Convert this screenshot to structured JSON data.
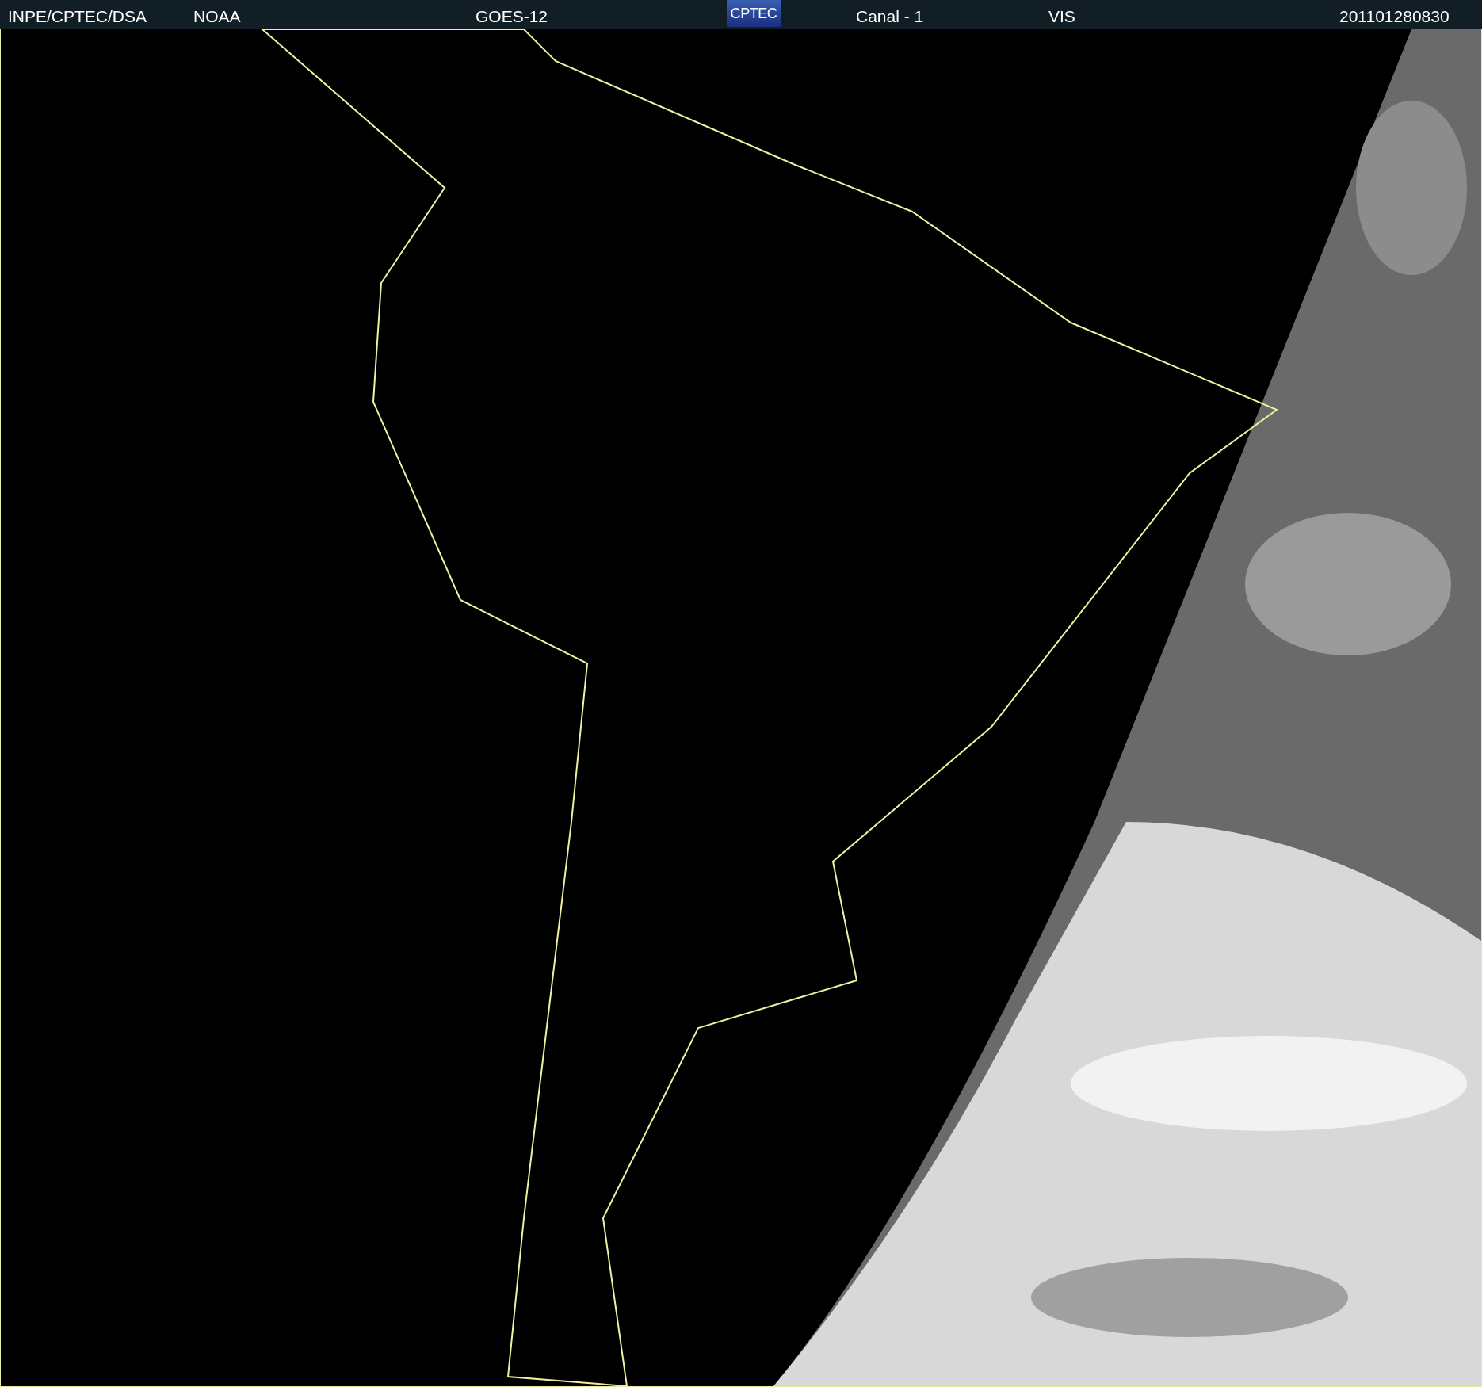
{
  "header": {
    "source": "INPE/CPTEC/DSA",
    "agency": "NOAA",
    "satellite": "GOES-12",
    "logo": "CPTEC",
    "channel": "Canal - 1",
    "band": "VIS",
    "timestamp": "201101280830"
  }
}
